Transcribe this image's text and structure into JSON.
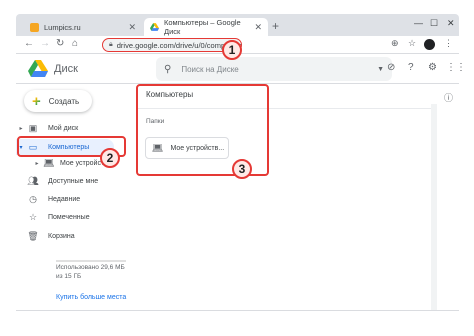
{
  "browser": {
    "tabs": [
      {
        "title": "Lumpics.ru",
        "favicon": "lumpics-icon"
      },
      {
        "title": "Компьютеры – Google Диск",
        "favicon": "gdrive-icon"
      }
    ],
    "url": "drive.google.com/drive/u/0/computers"
  },
  "app": {
    "name": "Диск",
    "search_placeholder": "Поиск на Диске"
  },
  "sidebar": {
    "create_label": "Создать",
    "items": [
      {
        "label": "Мой диск"
      },
      {
        "label": "Компьютеры"
      },
      {
        "label": "Мое устройст…"
      },
      {
        "label": "Доступные мне"
      },
      {
        "label": "Недавние"
      },
      {
        "label": "Помеченные"
      },
      {
        "label": "Корзина"
      }
    ],
    "storage_text": "Использовано 29,6 МБ из 15 ГБ",
    "buy_link": "Купить больше места"
  },
  "main": {
    "title": "Компьютеры",
    "section": "Папки",
    "folder_label": "Мое устройств..."
  },
  "badges": [
    "1",
    "2",
    "3"
  ],
  "colors": {
    "highlight": "#e53935",
    "selected_bg": "#e8f0fe",
    "selected_text": "#1967d2"
  }
}
